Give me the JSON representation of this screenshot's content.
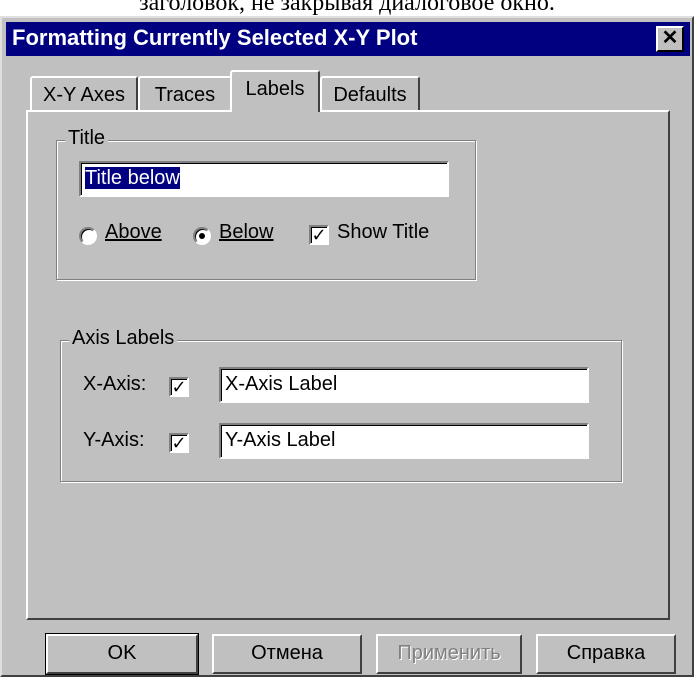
{
  "caption_fragment": "заголовок, не закрывая диалоговое окно.",
  "window": {
    "title": "Formatting Currently Selected X-Y Plot",
    "close_glyph": "✕"
  },
  "tabs": [
    {
      "label": "X-Y Axes",
      "active": false
    },
    {
      "label": "Traces",
      "active": false
    },
    {
      "label": "Labels",
      "active": true
    },
    {
      "label": "Defaults",
      "active": false
    }
  ],
  "title_group": {
    "label": "Title",
    "title_value": "Title below",
    "above_label": "Above",
    "below_label": "Below",
    "selected_position": "Below",
    "show_title_label": "Show Title",
    "show_title_checked": true
  },
  "axis_group": {
    "label": "Axis Labels",
    "x_label": "X-Axis:",
    "x_checked": true,
    "x_value": "X-Axis Label",
    "y_label": "Y-Axis:",
    "y_checked": true,
    "y_value": "Y-Axis Label"
  },
  "buttons": {
    "ok": "OK",
    "cancel": "Отмена",
    "apply": "Применить",
    "help": "Справка"
  },
  "icons": {
    "close": "close-icon",
    "check": "checkmark-icon",
    "radio": "radio-dot-icon"
  }
}
